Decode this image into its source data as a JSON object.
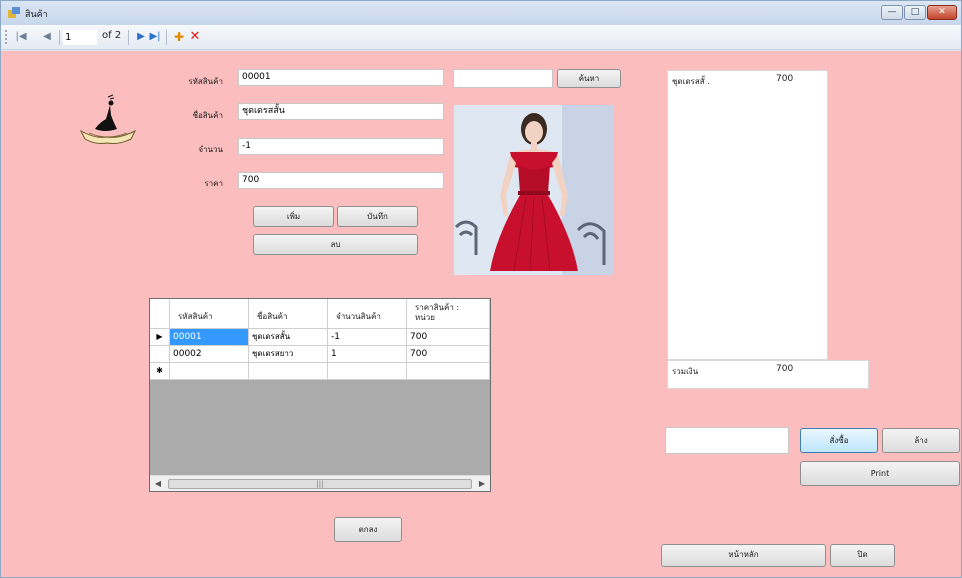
{
  "window": {
    "title": "สินค้า",
    "minimize_glyph": "—",
    "maximize_glyph": "□",
    "close_glyph": "✕"
  },
  "navigator": {
    "first_glyph": "|◀",
    "prev_glyph": "◀",
    "position": "1",
    "of_text": "of 2",
    "next_glyph": "▶",
    "last_glyph": "▶|",
    "add_glyph": "✚",
    "delete_glyph": "✕",
    "add_color": "#e08a00",
    "delete_color": "#e02020"
  },
  "form": {
    "id_label": "รหัสสินค้า",
    "id_value": "00001",
    "name_label": "ชื่อสินค้า",
    "name_value": "ชุดเดรสสั้น",
    "qty_label": "จำนวน",
    "qty_value": "-1",
    "price_label": "ราคา",
    "price_value": "700",
    "search_value": "",
    "search_button": "ค้นหา",
    "add_button": "เพิ่ม",
    "save_button": "บันทึก",
    "delete_button": "ลบ"
  },
  "grid": {
    "columns": [
      "รหัสสินค้า",
      "ชื่อสินค้า",
      "จำนวนสินค้า",
      "ราคาสินค้า :\nหน่วย"
    ],
    "rows": [
      [
        "00001",
        "ชุดเดรสสั้น",
        "-1",
        "700"
      ],
      [
        "00002",
        "ชุดเดรสยาว",
        "1",
        "700"
      ]
    ],
    "current_row_glyph": "▶",
    "new_row_glyph": "✱",
    "scroll_left": "◀",
    "scroll_right": "▶",
    "scroll_thumb_grip": "|||"
  },
  "cart": {
    "item_name": "ชุดเดรสสั้ .",
    "item_price": "700",
    "total_label": "รวมเงิน",
    "total_value": "700",
    "input_value": "",
    "order_button": "สั่งซื้อ",
    "clear_button": "ล้าง",
    "print_button": "Print"
  },
  "bottom": {
    "ok_button": "ตกลง",
    "home_button": "หน้าหลัก",
    "close_button": "ปิด"
  },
  "colors": {
    "form_background": "#fbbdbe",
    "selected_cell": "#3399ff",
    "dress": "#c8102e"
  }
}
